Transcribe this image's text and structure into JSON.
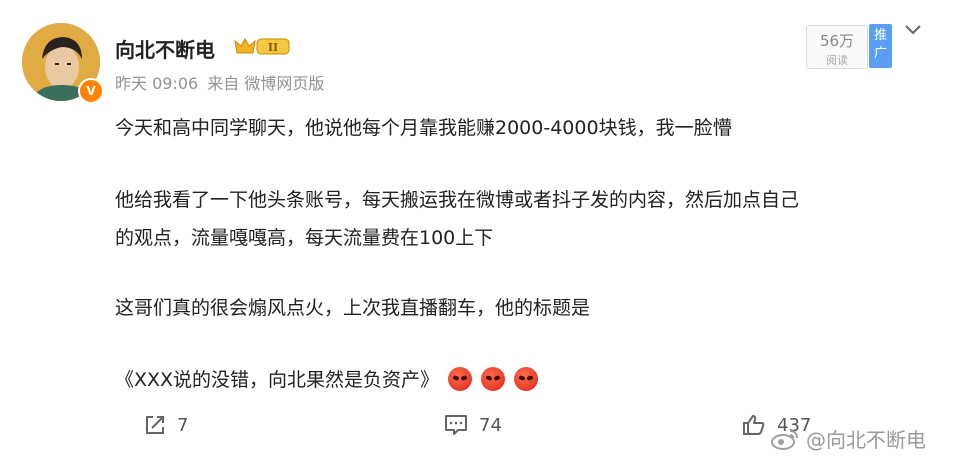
{
  "author": {
    "name": "向北不断电",
    "level_badge": "II"
  },
  "meta": {
    "time": "昨天 09:06",
    "source": "来自 微博网页版"
  },
  "reads": {
    "count": "56万",
    "label": "阅读"
  },
  "promote": {
    "line1": "推",
    "line2": "广"
  },
  "post": {
    "line1": "今天和高中同学聊天，他说他每个月靠我能赚2000-4000块钱，我一脸懵",
    "line2": "他给我看了一下他头条账号，每天搬运我在微博或者抖子发的内容，然后加点自己",
    "line3": "的观点，流量嘎嘎高，每天流量费在100上下",
    "line4": "这哥们真的很会煽风点火，上次我直播翻车，他的标题是",
    "line5": "《XXX说的没错，向北果然是负资产》"
  },
  "actions": {
    "repost_count": "7",
    "comment_count": "74",
    "like_count": "437"
  },
  "watermark": {
    "text": "@向北不断电"
  },
  "icons": {
    "avatar": "avatar-icon",
    "verified": "verified-badge-icon",
    "crown": "crown-badge-icon",
    "more": "chevron-down-icon",
    "repost": "repost-icon",
    "comment": "comment-icon",
    "like": "thumbs-up-icon",
    "emoji": "angry-face-icon",
    "weibo": "weibo-logo-icon"
  },
  "colors": {
    "promote_bg": "#5b9ef5",
    "verified": "#ff8200",
    "meta_text": "#939393"
  }
}
